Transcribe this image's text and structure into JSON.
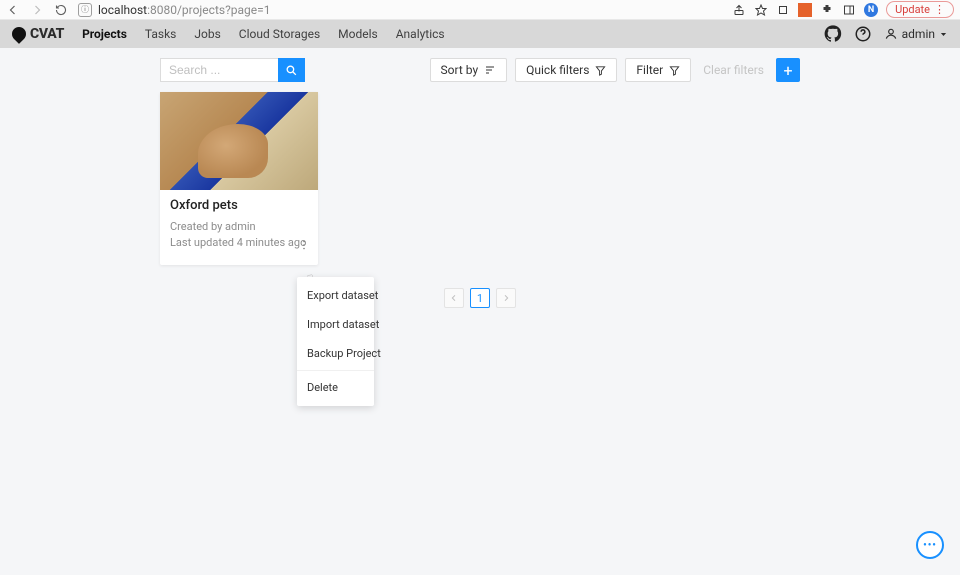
{
  "browser": {
    "url_host": "localhost",
    "url_path": ":8080/projects?page=1",
    "update_label": "Update",
    "ext_n": "N"
  },
  "nav": {
    "items": [
      {
        "label": "Projects",
        "active": true
      },
      {
        "label": "Tasks",
        "active": false
      },
      {
        "label": "Jobs",
        "active": false
      },
      {
        "label": "Cloud Storages",
        "active": false
      },
      {
        "label": "Models",
        "active": false
      },
      {
        "label": "Analytics",
        "active": false
      }
    ],
    "brand": "CVAT",
    "user": "admin"
  },
  "toolbar": {
    "search_placeholder": "Search ...",
    "sort_label": "Sort by",
    "quick_filters_label": "Quick filters",
    "filter_label": "Filter",
    "clear_filters_label": "Clear filters",
    "add_label": "+"
  },
  "project_card": {
    "title": "Oxford pets",
    "created": "Created by admin",
    "updated": "Last updated 4 minutes ago"
  },
  "dropdown": {
    "items": [
      "Export dataset",
      "Import dataset",
      "Backup Project",
      "Delete"
    ]
  },
  "pagination": {
    "current": "1"
  },
  "fab": {
    "glyph": "•••"
  }
}
